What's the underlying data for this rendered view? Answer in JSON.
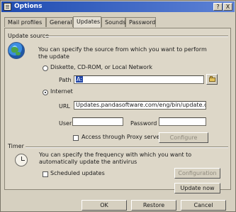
{
  "window": {
    "title": "Options",
    "help_label": "?",
    "close_label": "X"
  },
  "tabs": [
    {
      "label": "Mail profiles",
      "active": false
    },
    {
      "label": "General",
      "active": false
    },
    {
      "label": "Updates",
      "active": true
    },
    {
      "label": "Sounds",
      "active": false
    },
    {
      "label": "Password",
      "active": false
    }
  ],
  "update_source": {
    "title": "Update source",
    "description": "You can specify the source from which you want to perform the update",
    "local_option_label": "Diskette, CD-ROM, or Local Network",
    "path_label": "Path",
    "path_value": "A:",
    "internet_option_label": "Internet",
    "url_label": "URL",
    "url_value": "Updates.pandasoftware.com/eng/bin/update.cgi",
    "user_label": "User",
    "user_value": "",
    "password_label": "Password",
    "password_value": "",
    "proxy_label": "Access through Proxy server",
    "configure_label": "Configure"
  },
  "timer": {
    "title": "Timer",
    "description": "You can specify the frequency with which you want to automatically update the antivirus",
    "scheduled_label": "Scheduled updates",
    "configuration_label": "Configuration",
    "update_now_label": "Update now"
  },
  "footer": {
    "ok_label": "OK",
    "restore_label": "Restore",
    "cancel_label": "Cancel"
  }
}
